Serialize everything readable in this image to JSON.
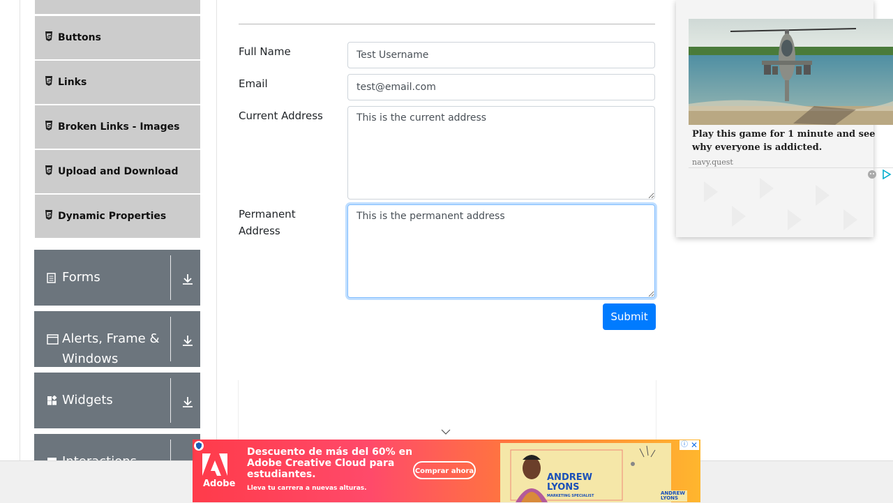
{
  "sidebar": {
    "elements_items": [
      {
        "label": "Buttons"
      },
      {
        "label": "Links"
      },
      {
        "label": "Broken Links - Images"
      },
      {
        "label": "Upload and Download"
      },
      {
        "label": "Dynamic Properties"
      }
    ],
    "groups": [
      {
        "label": "Forms",
        "icon": "form-icon"
      },
      {
        "label": "Alerts, Frame &",
        "label2": "Windows",
        "icon": "window-icon"
      },
      {
        "label": "Widgets",
        "icon": "widgets-icon"
      },
      {
        "label": "Interactions",
        "icon": "interactions-icon"
      }
    ]
  },
  "form": {
    "full_name_label": "Full Name",
    "full_name_value": "Test Username",
    "email_label": "Email",
    "email_value": "test@email.com",
    "current_address_label": "Current Address",
    "current_address_value": "This is the current address",
    "permanent_address_label1": "Permanent",
    "permanent_address_label2": "Address",
    "permanent_address_value": "This is the permanent address",
    "submit_label": "Submit"
  },
  "right_ad": {
    "text": "Play this game for 1 minute and see why everyone is addicted.",
    "source": "navy.quest"
  },
  "bottom_ad": {
    "brand": "Adobe",
    "headline": "Descuento de más del 60% en Adobe Creative Cloud para estudiantes.",
    "sub": "Lleva tu carrera a nuevas alturas.",
    "button": "Comprar ahora",
    "name_line1": "ANDREW",
    "name_line2": "LYONS",
    "role": "MARKETING SPECIALIST",
    "card_line1": "ANDREW",
    "card_line2": "LYONS"
  },
  "colors": {
    "submit_bg": "#007bff",
    "group_bg": "#6c757d",
    "subitem_bg": "#cccccc"
  }
}
